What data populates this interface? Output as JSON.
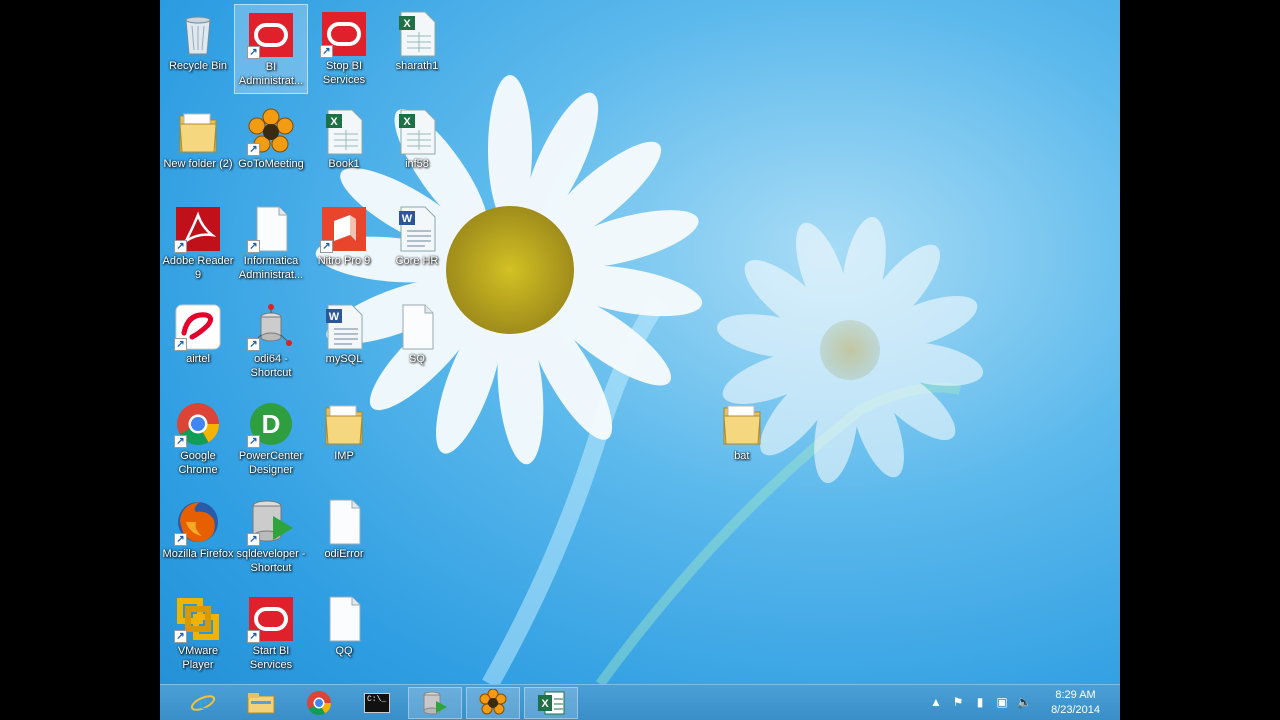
{
  "desktop": {
    "icons": [
      {
        "label": "Recycle Bin",
        "icon": "recycle-bin-icon"
      },
      {
        "label": "BI Administrat...",
        "icon": "oracle-icon",
        "selected": true
      },
      {
        "label": "Stop BI Services",
        "icon": "oracle-icon"
      },
      {
        "label": "sharath1",
        "icon": "excel-file-icon"
      },
      {
        "label": "New folder (2)",
        "icon": "folder-icon"
      },
      {
        "label": "GoToMeeting",
        "icon": "gotomeeting-icon"
      },
      {
        "label": "Book1",
        "icon": "excel-file-icon"
      },
      {
        "label": "inf58",
        "icon": "excel-file-icon"
      },
      {
        "label": "Adobe Reader 9",
        "icon": "adobe-reader-icon"
      },
      {
        "label": "Informatica Administrat...",
        "icon": "blank-file-icon"
      },
      {
        "label": "Nitro Pro 9",
        "icon": "nitro-icon"
      },
      {
        "label": "Core HR",
        "icon": "word-file-icon"
      },
      {
        "label": "airtel",
        "icon": "airtel-icon"
      },
      {
        "label": "odi64 - Shortcut",
        "icon": "odi-icon"
      },
      {
        "label": "mySQL",
        "icon": "word-file-icon"
      },
      {
        "label": "SQ",
        "icon": "blank-file-icon"
      },
      {
        "label": "Google Chrome",
        "icon": "chrome-icon"
      },
      {
        "label": "PowerCenter Designer",
        "icon": "powercenter-icon"
      },
      {
        "label": "IMP",
        "icon": "folder-icon"
      },
      {
        "label": "bat",
        "icon": "folder-icon"
      },
      {
        "label": "Mozilla Firefox",
        "icon": "firefox-icon"
      },
      {
        "label": "sqldeveloper - Shortcut",
        "icon": "sqldeveloper-icon"
      },
      {
        "label": "odiError",
        "icon": "blank-file-icon"
      },
      {
        "label": "VMware Player",
        "icon": "vmware-icon"
      },
      {
        "label": "Start BI Services",
        "icon": "oracle-icon"
      },
      {
        "label": "QQ",
        "icon": "blank-file-icon"
      }
    ]
  },
  "taskbar": {
    "buttons": [
      {
        "icon": "internet-explorer-icon"
      },
      {
        "icon": "file-explorer-icon"
      },
      {
        "icon": "chrome-icon"
      },
      {
        "icon": "command-prompt-icon",
        "text": "C:\\_"
      },
      {
        "icon": "sqldeveloper-icon"
      },
      {
        "icon": "gotomeeting-icon"
      },
      {
        "icon": "excel-icon"
      }
    ],
    "clock": {
      "time": "8:29 AM",
      "date": "8/23/2014"
    }
  },
  "colors": {
    "desktop_blue": "#2f9ee2",
    "taskbar": "#3a8ec8",
    "oracle_red": "#e0202a"
  }
}
